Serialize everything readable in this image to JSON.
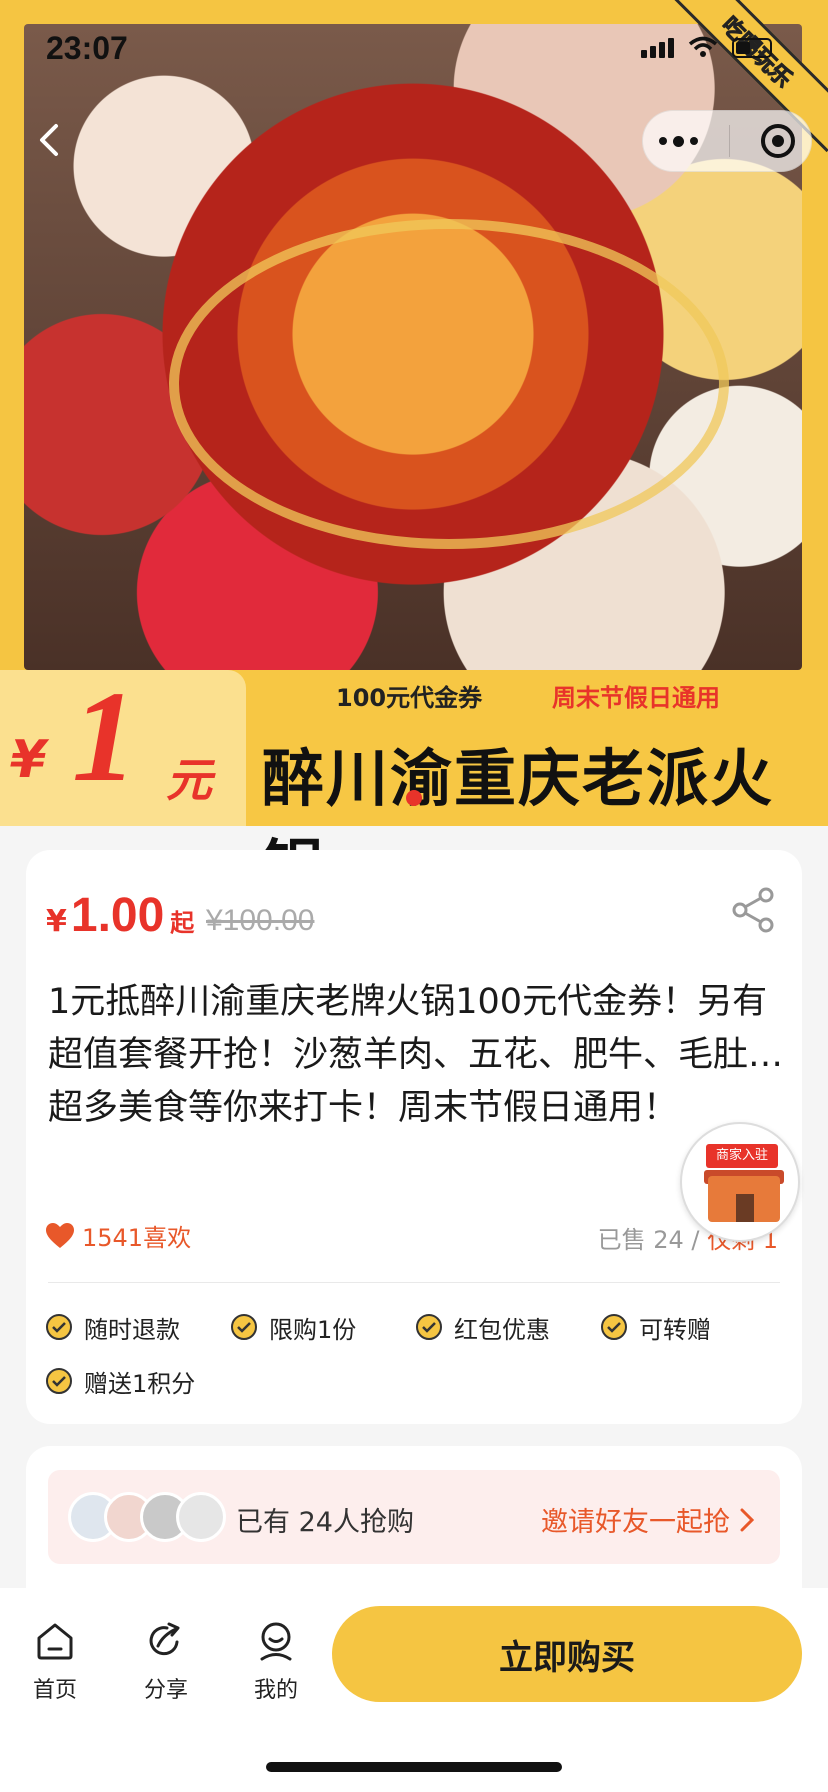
{
  "status_bar": {
    "time": "23:07"
  },
  "hero": {
    "corner_badge": "吃喝玩乐",
    "banner": {
      "price_symbol": "¥",
      "price_amount": "1",
      "price_unit": "元",
      "subtitle_left": "100元代金券",
      "subtitle_right": "周末节假日通用",
      "title": "醉川渝重庆老派火锅"
    }
  },
  "product": {
    "currency": "¥",
    "price": "1.00",
    "price_suffix": "起",
    "original_price": "¥100.00",
    "description": "1元抵醉川渝重庆老牌火锅100元代金券！另有超值套餐开抢！沙葱羊肉、五花、肥牛、毛肚…超多美食等你来打卡！周末节假日通用！",
    "likes": "1541喜欢",
    "sold": "已售 24 / ",
    "remaining": "仅剩 1",
    "tags": [
      "随时退款",
      "限购1份",
      "红包优惠",
      "可转赠",
      "赠送1积分"
    ]
  },
  "merchant_badge": {
    "label": "商家入驻"
  },
  "invite": {
    "count_text": "已有 24人抢购",
    "cta": "邀请好友一起抢"
  },
  "tabbar": {
    "items": [
      {
        "label": "首页",
        "icon": "home-icon"
      },
      {
        "label": "分享",
        "icon": "share-icon"
      },
      {
        "label": "我的",
        "icon": "profile-icon"
      }
    ],
    "buy_label": "立即购买"
  },
  "colors": {
    "accent": "#f5c542",
    "price_red": "#e8332a",
    "orange": "#e8582a"
  }
}
